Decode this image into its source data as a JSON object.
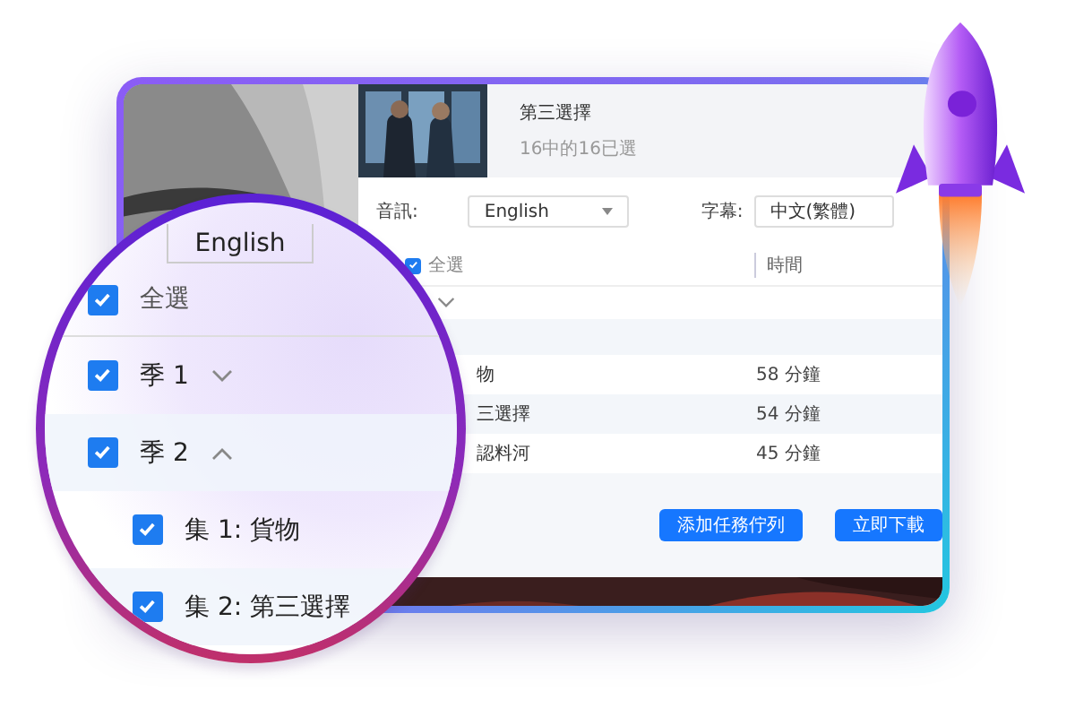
{
  "window": {
    "media": {
      "title": "第三選擇",
      "subtitle": "16中的16已選"
    },
    "audio": {
      "label": "音訊:",
      "value": "English"
    },
    "subtitles": {
      "label": "字幕:",
      "value": "中文(繁體)"
    },
    "table": {
      "select_all": {
        "label": "全選",
        "checked": true
      },
      "columns": [
        "時間"
      ],
      "season_row": {
        "expanded": false
      },
      "rows": [
        {
          "title": "物",
          "duration": "58 分鐘"
        },
        {
          "title": "三選擇",
          "duration": "54 分鐘"
        },
        {
          "title": "認料河",
          "duration": "45 分鐘"
        }
      ]
    },
    "buttons": [
      "添加任務佇列",
      "立即下載"
    ]
  },
  "magnifier": {
    "select_value": "English",
    "select_all": {
      "label": "全選",
      "checked": true
    },
    "seasons": [
      {
        "label": "季 1",
        "checked": true,
        "expanded": false
      },
      {
        "label": "季 2",
        "checked": true,
        "expanded": true,
        "children": [
          {
            "label": "集 1: 貨物",
            "checked": true
          },
          {
            "label": "集 2: 第三選擇",
            "checked": true
          }
        ]
      }
    ]
  }
}
